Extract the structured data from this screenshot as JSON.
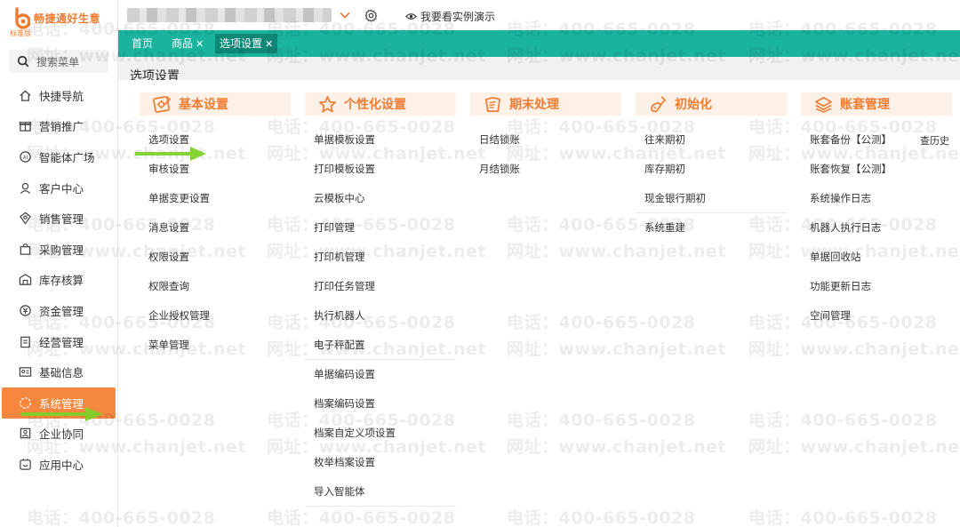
{
  "brand": {
    "name": "畅捷通好生意",
    "edition": "标准版",
    "color": "#f07c32"
  },
  "search": {
    "placeholder": "搜索菜单"
  },
  "sidebar": {
    "items": [
      {
        "label": "快捷导航",
        "icon": "home-icon"
      },
      {
        "label": "营销推广",
        "icon": "gift-icon"
      },
      {
        "label": "智能体广场",
        "icon": "ai-icon"
      },
      {
        "label": "客户中心",
        "icon": "user-icon"
      },
      {
        "label": "销售管理",
        "icon": "sales-icon"
      },
      {
        "label": "采购管理",
        "icon": "bag-icon"
      },
      {
        "label": "库存核算",
        "icon": "warehouse-icon"
      },
      {
        "label": "资金管理",
        "icon": "money-icon"
      },
      {
        "label": "经营管理",
        "icon": "clipboard-icon"
      },
      {
        "label": "基础信息",
        "icon": "id-card-icon"
      },
      {
        "label": "系统管理",
        "icon": "settings-icon",
        "active": true
      },
      {
        "label": "企业协同",
        "icon": "team-icon"
      },
      {
        "label": "应用中心",
        "icon": "apps-icon"
      }
    ]
  },
  "topbar": {
    "demo_label": "我要看实例演示"
  },
  "tabs": [
    {
      "label": "首页",
      "closable": false
    },
    {
      "label": "商品",
      "closable": true
    },
    {
      "label": "选项设置",
      "closable": true,
      "active": true
    }
  ],
  "page": {
    "title": "选项设置"
  },
  "columns": [
    {
      "title": "基本设置",
      "icon": "settings-card-icon",
      "items": [
        "选项设置",
        "审核设置",
        "单据变更设置",
        "消息设置",
        "权限设置",
        "权限查询",
        "企业授权管理",
        "菜单管理"
      ]
    },
    {
      "title": "个性化设置",
      "icon": "star-icon",
      "items": [
        "单据模板设置",
        "打印模板设置",
        "云模板中心",
        "打印管理",
        "打印机管理",
        "打印任务管理",
        "执行机器人",
        "电子秤配置",
        "单据编码设置",
        "档案编码设置",
        "档案自定义项设置",
        "枚举档案设置",
        "导入智能体"
      ]
    },
    {
      "title": "期末处理",
      "icon": "ledger-icon",
      "items": [
        "日结锁账",
        "月结锁账"
      ]
    },
    {
      "title": "初始化",
      "icon": "broom-icon",
      "items": [
        "往来期初",
        "库存期初",
        "现金银行期初",
        "系统重建"
      ]
    },
    {
      "title": "账套管理",
      "icon": "stack-icon",
      "items": [
        "账套备份【公测】",
        "账套恢复【公测】",
        "系统操作日志",
        "机器人执行日志",
        "单据回收站",
        "功能更新日志",
        "空间管理"
      ]
    }
  ],
  "history_link": "查历史",
  "watermark": {
    "phone": "电话：400-665-0028",
    "site": "网址：www.chanjet.net"
  },
  "colors": {
    "accent": "#f07c32",
    "tabbar": "#1ab39d",
    "active_tab": "#0f8776",
    "active_nav": "#f5883e",
    "arrow": "#7fd12a"
  }
}
